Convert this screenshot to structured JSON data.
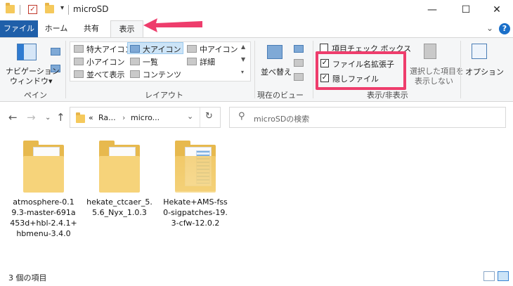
{
  "window": {
    "title": "microSD",
    "minimize_glyph": "—",
    "maximize_glyph": "☐",
    "close_glyph": "✕"
  },
  "ribbon_tabs": [
    {
      "label": "ファイル"
    },
    {
      "label": "ホーム"
    },
    {
      "label": "共有"
    },
    {
      "label": "表示"
    }
  ],
  "help": {
    "glyph": "?"
  },
  "ribbon": {
    "pane": {
      "nav_pane_line1": "ナビゲーション",
      "nav_pane_line2": "ウィンドウ▾",
      "group_label": "ペイン"
    },
    "layout": {
      "items": [
        "特大アイコン",
        "大アイコン",
        "中アイコン",
        "小アイコン",
        "一覧",
        "詳細",
        "並べて表示",
        "コンテンツ"
      ],
      "group_label": "レイアウト"
    },
    "current_view": {
      "sort_label": "並べ替え",
      "group_label": "現在のビュー"
    },
    "show_hide": {
      "item_checkboxes": "項目チェック ボックス",
      "file_extensions": "ファイル名拡張子",
      "hidden_files": "隠しファイル",
      "hide_selected_line1": "選択した項目を",
      "hide_selected_line2": "表示しない",
      "group_label": "表示/非表示"
    },
    "options": {
      "label": "オプション"
    }
  },
  "address": {
    "breadcrumb_prefix": "«",
    "crumb1": "Ra...",
    "crumb2": "micro...",
    "search_placeholder": "microSDの検索"
  },
  "files": [
    {
      "name": "atmosphere-0.19.3-master-691a453d+hbl-2.4.1+hbmenu-3.4.0"
    },
    {
      "name": "hekate_ctcaer_5.5.6_Nyx_1.0.3"
    },
    {
      "name": "Hekate+AMS-fss0-sigpatches-19.3-cfw-12.0.2"
    }
  ],
  "status": {
    "item_count": "3 個の項目"
  },
  "colors": {
    "file_tab": "#1f5fa9",
    "annotation": "#ee3d6c",
    "folder": "#f6d37a"
  }
}
